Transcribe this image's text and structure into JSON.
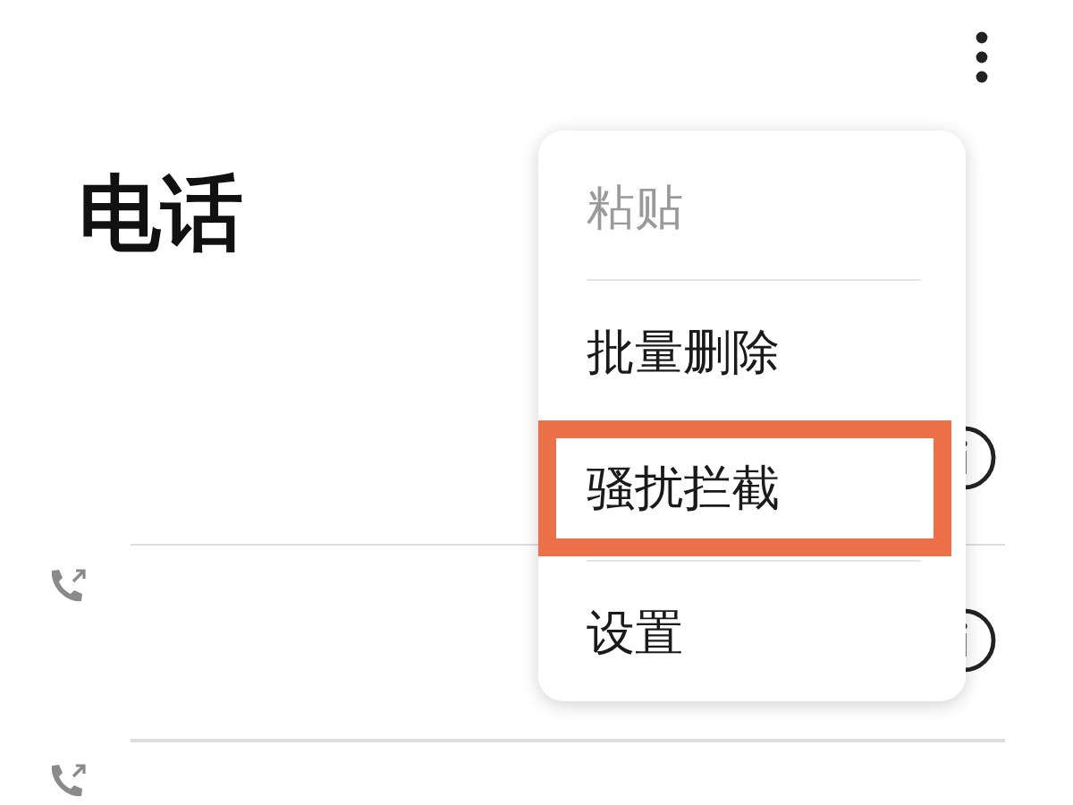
{
  "title": "电话",
  "menu": {
    "groups": [
      [
        {
          "label": "粘贴",
          "disabled": true,
          "highlighted": false
        }
      ],
      [
        {
          "label": "批量删除",
          "disabled": false,
          "highlighted": false
        },
        {
          "label": "骚扰拦截",
          "disabled": false,
          "highlighted": true
        }
      ],
      [
        {
          "label": "设置",
          "disabled": false,
          "highlighted": false
        }
      ]
    ]
  }
}
